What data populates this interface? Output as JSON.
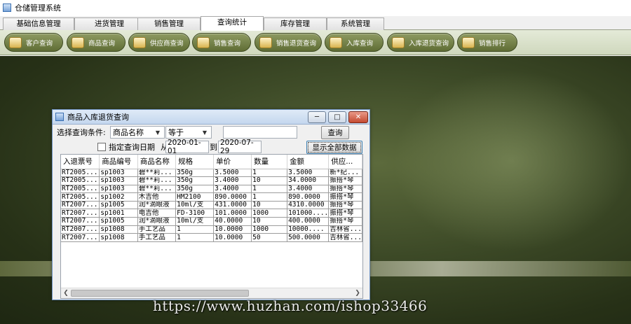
{
  "window": {
    "title": "仓储管理系统"
  },
  "menu_tabs": [
    {
      "label": "基础信息管理",
      "active": false
    },
    {
      "label": "进货管理",
      "active": false
    },
    {
      "label": "销售管理",
      "active": false
    },
    {
      "label": "查询统计",
      "active": true
    },
    {
      "label": "库存管理",
      "active": false
    },
    {
      "label": "系统管理",
      "active": false
    }
  ],
  "toolbar": [
    {
      "label": "客户查询",
      "icon": "customer-icon"
    },
    {
      "label": "商品查询",
      "icon": "product-icon"
    },
    {
      "label": "供应商查询",
      "icon": "supplier-icon"
    },
    {
      "label": "销售查询",
      "icon": "sales-icon"
    },
    {
      "label": "销售退货查询",
      "icon": "sales-return-icon"
    },
    {
      "label": "入库查询",
      "icon": "stock-in-icon"
    },
    {
      "label": "入库退货查询",
      "icon": "stock-in-return-icon"
    },
    {
      "label": "销售排行",
      "icon": "ranking-icon"
    }
  ],
  "dialog": {
    "title": "商品入库退货查询",
    "condition_label": "选择查询条件:",
    "field_select": "商品名称",
    "operator_select": "等于",
    "search_value": "",
    "search_button": "查询",
    "date_checkbox_label": "指定查询日期",
    "date_from_label": "从",
    "date_from": "2020-01-01",
    "date_to_label": "到",
    "date_to": "2020-07-29",
    "show_all_button": "显示全部数据",
    "table": {
      "columns": [
        "入退票号",
        "商品编号",
        "商品名称",
        "规格",
        "单价",
        "数量",
        "金额",
        "供应..."
      ],
      "rows": [
        [
          "RT2005...",
          "sp1003",
          "碧**莉...",
          "350g",
          "3.5000",
          "1",
          "3.5000",
          "新*纪..."
        ],
        [
          "RT2005...",
          "sp1003",
          "碧**莉...",
          "350g",
          "3.4000",
          "10",
          "34.0000",
          "振搭*琴"
        ],
        [
          "RT2005...",
          "sp1003",
          "碧**莉...",
          "350g",
          "3.4000",
          "1",
          "3.4000",
          "振搭*琴"
        ],
        [
          "RT2005...",
          "sp1002",
          "木吉他",
          "HM2100",
          "890.0000",
          "1",
          "890.0000",
          "振搭*琴"
        ],
        [
          "RT2007...",
          "sp1005",
          "润*滴眼液",
          "10ml/支",
          "431.0000",
          "10",
          "4310.0000",
          "振搭*琴"
        ],
        [
          "RT2007...",
          "sp1001",
          "电吉他",
          "FD-3100",
          "101.0000",
          "1000",
          "101000....",
          "振搭*琴"
        ],
        [
          "RT2007...",
          "sp1005",
          "润*滴眼液",
          "10ml/支",
          "40.0000",
          "10",
          "400.0000",
          "振搭*琴"
        ],
        [
          "RT2007...",
          "sp1008",
          "手工艺品",
          "1",
          "10.0000",
          "1000",
          "10000....",
          "吉林省..."
        ],
        [
          "RT2007...",
          "sp1008",
          "手工艺品",
          "1",
          "10.0000",
          "50",
          "500.0000",
          "吉林省..."
        ]
      ]
    }
  },
  "watermark": "https://www.huzhan.com/ishop33466"
}
